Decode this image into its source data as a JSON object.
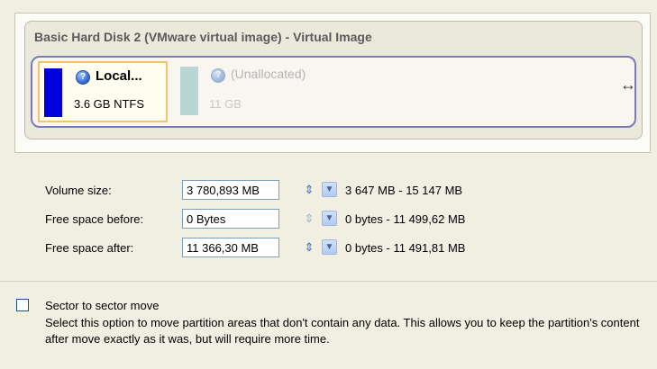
{
  "disk": {
    "title": "Basic Hard Disk 2 (VMware virtual image) - Virtual Image",
    "partitions": [
      {
        "name": "Local...",
        "info": "3.6 GB NTFS",
        "color": "#0000dd"
      },
      {
        "name": "(Unallocated)",
        "info": "11 GB",
        "color": "#b8d7d2"
      }
    ]
  },
  "fields": {
    "volume_size": {
      "label": "Volume size:",
      "value": "3 780,893 MB",
      "range": "3 647 MB - 15 147 MB"
    },
    "free_before": {
      "label": "Free space before:",
      "value": "0 Bytes",
      "range": "0 bytes - 11 499,62 MB"
    },
    "free_after": {
      "label": "Free space after:",
      "value": "11 366,30 MB",
      "range": "0 bytes - 11 491,81 MB"
    }
  },
  "sector_move": {
    "label": "Sector to sector move",
    "checked": false,
    "description": "Select this option to move partition areas that don't contain any data. This allows you to keep the partition's content after move exactly as it was, but will require more time."
  },
  "colors": {
    "accent": "#7a7ab8",
    "selection": "#f2c56c",
    "background": "#f1efe2"
  }
}
